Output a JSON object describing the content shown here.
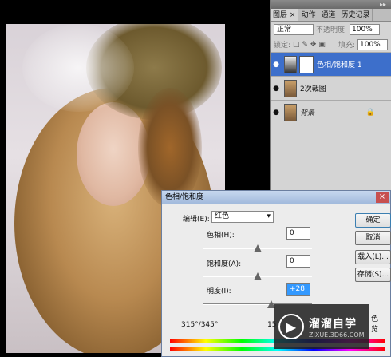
{
  "layers_panel": {
    "tabs": [
      "图层",
      "动作",
      "通道",
      "历史记录"
    ],
    "tab_close": "×",
    "blend_mode": "正常",
    "opacity_label": "不透明度:",
    "opacity_value": "100%",
    "lock_label": "锁定:",
    "fill_label": "填充:",
    "fill_value": "100%",
    "layers": [
      {
        "name": "色相/饱和度 1",
        "active": true
      },
      {
        "name": "2次裁图",
        "active": false
      },
      {
        "name": "背景",
        "active": false
      }
    ]
  },
  "dialog": {
    "title": "色相/饱和度",
    "close": "×",
    "edit_label": "编辑(E):",
    "edit_value": "红色",
    "hue_label": "色相(H):",
    "hue_value": "0",
    "saturation_label": "饱和度(A):",
    "saturation_value": "0",
    "lightness_label": "明度(I):",
    "lightness_value": "+28",
    "range_text": "315°/345°",
    "range_text_right": "15",
    "ok": "确定",
    "cancel": "取消",
    "load": "载入(L)...",
    "save": "存储(S)...",
    "colorize": "色",
    "preview": "览"
  },
  "watermark": {
    "logo": "▶",
    "title": "溜溜自学",
    "url": "ZIXUE.3D66.COM"
  }
}
